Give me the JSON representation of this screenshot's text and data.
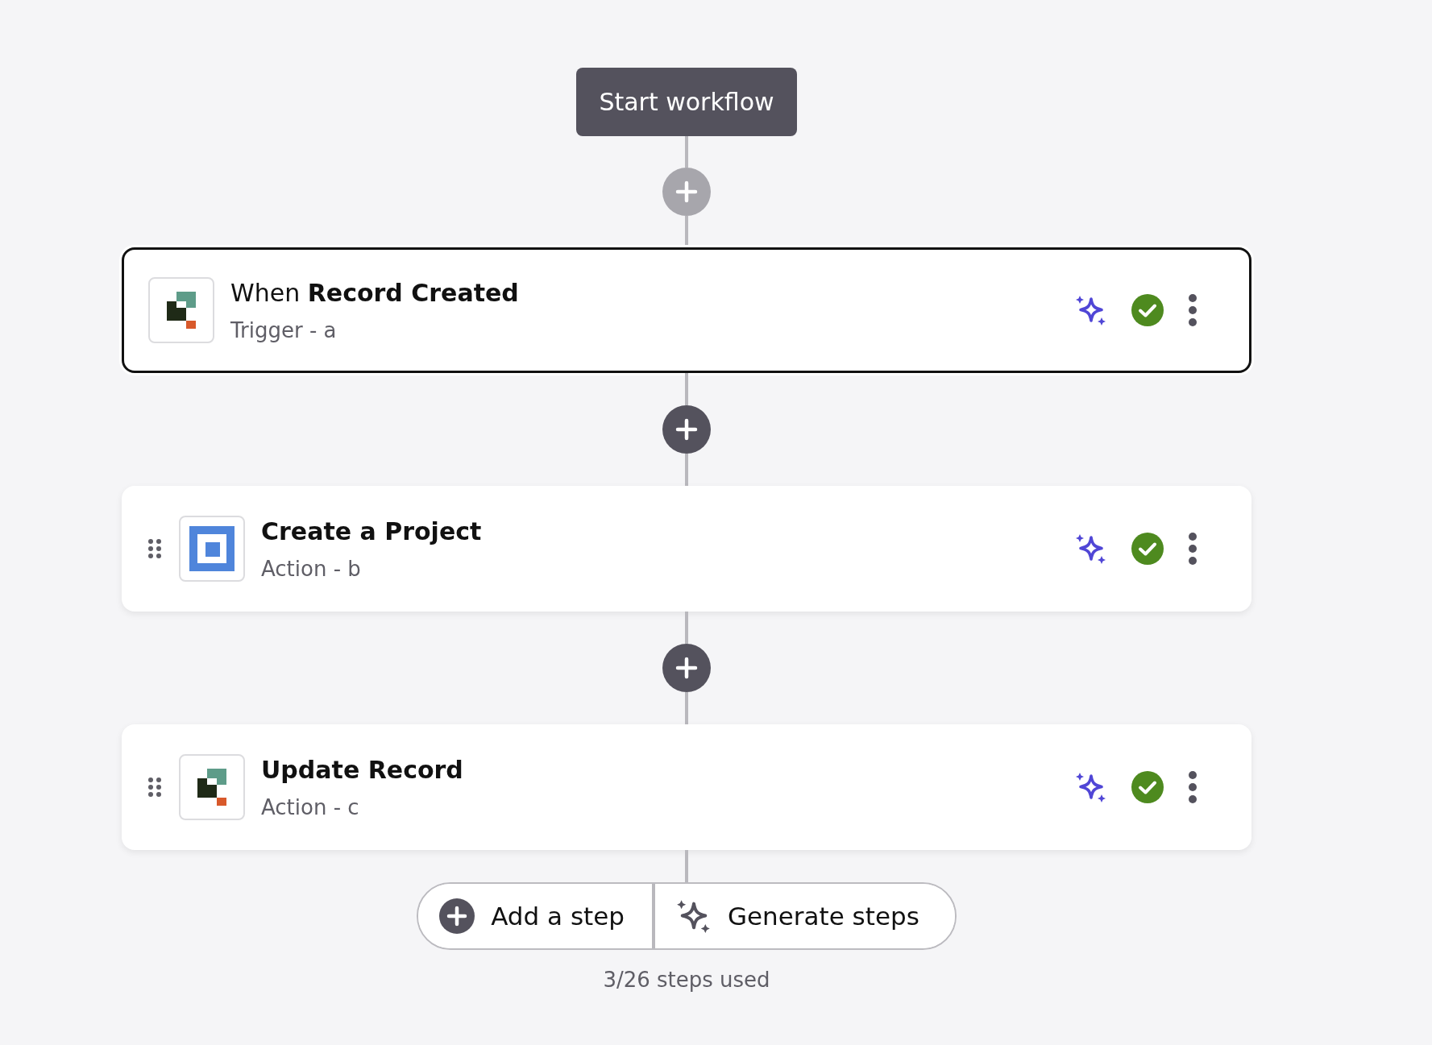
{
  "start_button": {
    "label": "Start workflow"
  },
  "inserts": [
    {
      "disabled": true
    },
    {
      "disabled": false
    },
    {
      "disabled": false
    }
  ],
  "steps": [
    {
      "kind": "trigger",
      "logo": {
        "kind": "records"
      },
      "title": "When **Record Created**",
      "subtitle": "Trigger - a",
      "selected": true
    },
    {
      "kind": "action",
      "logo": {
        "kind": "projects"
      },
      "title": "Create a Project",
      "subtitle": "Action - b",
      "selected": false
    },
    {
      "kind": "action",
      "logo": {
        "kind": "records"
      },
      "title": "Update Record",
      "subtitle": "Action - c",
      "selected": false
    }
  ],
  "footer": {
    "add_label": "Add a step",
    "generate_label": "Generate steps",
    "usage": "3/26 steps used"
  }
}
